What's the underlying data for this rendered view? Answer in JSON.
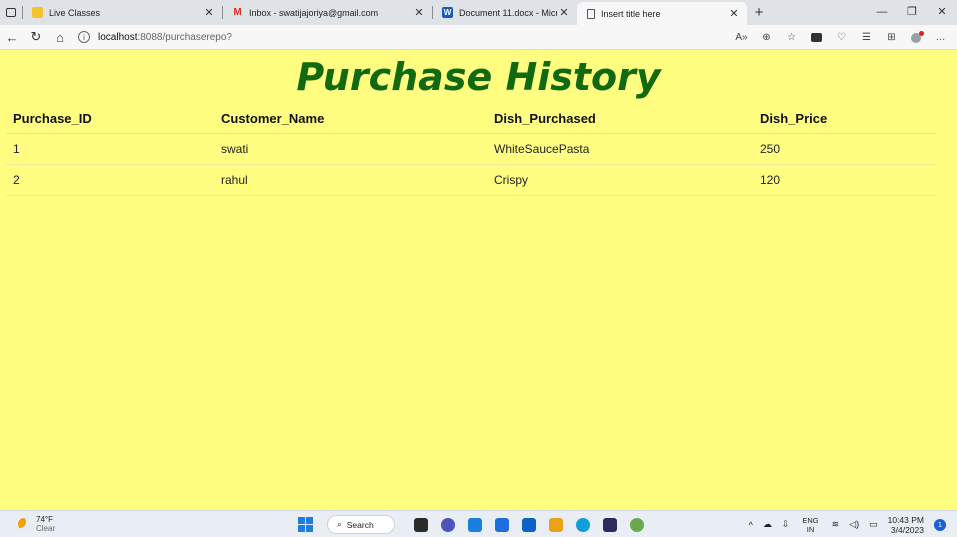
{
  "browser": {
    "tabs": [
      {
        "title": "Live Classes",
        "icon": "bookmark-icon",
        "color": "#f4c430"
      },
      {
        "title": "Inbox - swatijajoriya@gmail.com",
        "icon": "gmail-icon",
        "color": "#d93025"
      },
      {
        "title": "Document 11.docx - Microsoft W",
        "icon": "word-icon",
        "color": "#185abd"
      },
      {
        "title": "Insert title here",
        "icon": "page-icon",
        "color": "#555555"
      }
    ],
    "address": {
      "host": "localhost",
      "path": ":8088/purchaserepo?"
    }
  },
  "page": {
    "title": "Purchase History",
    "title_color": "#116a11",
    "background": "#fffe80",
    "table": {
      "headers": [
        "Purchase_ID",
        "Customer_Name",
        "Dish_Purchased",
        "Dish_Price"
      ],
      "rows": [
        [
          "1",
          "swati",
          "WhiteSaucePasta",
          "250"
        ],
        [
          "2",
          "rahul",
          "Crispy",
          "120"
        ]
      ]
    }
  },
  "taskbar": {
    "weather": {
      "temp": "74°F",
      "condition": "Clear"
    },
    "search_label": "Search",
    "language": {
      "line1": "ENG",
      "line2": "IN"
    },
    "time": "10:43 PM",
    "date": "3/4/2023",
    "notification_count": "1",
    "app_icon_colors": [
      "#2b2b2b",
      "#4b53bc",
      "#1a7fe0",
      "#1e6fd9",
      "#0a64c8",
      "#e8a317",
      "#0f9ed8",
      "#2b2b60",
      "#6aa84f"
    ]
  }
}
